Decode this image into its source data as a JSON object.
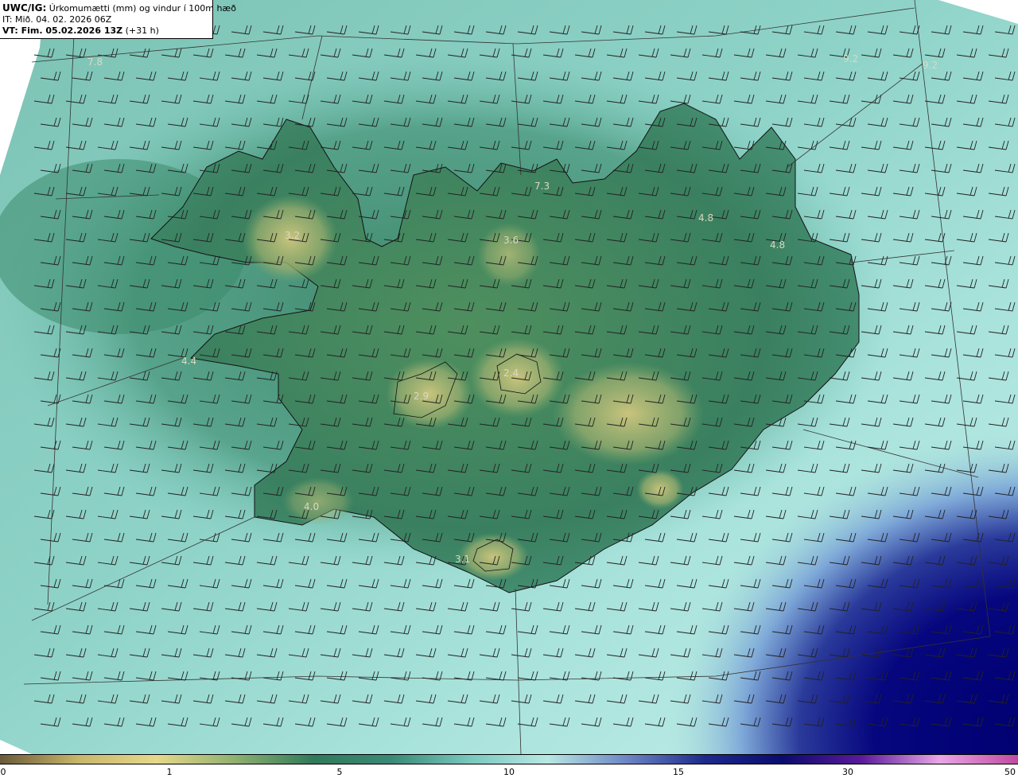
{
  "header": {
    "line1_bold": "UWC/IG:",
    "line1_rest": " Úrkomumætti (mm) og vindur í 100m hæð",
    "line2": "IT: Mið. 04. 02. 2026 06Z",
    "line3_bold": "VT: Fim. 05.02.2026 13Z",
    "line3_rest": " (+31 h)"
  },
  "map_labels": [
    {
      "text": "3.2"
    },
    {
      "text": "3.6"
    },
    {
      "text": "7.3"
    },
    {
      "text": "4.8"
    },
    {
      "text": "4.8"
    },
    {
      "text": "4.4"
    },
    {
      "text": "2.9"
    },
    {
      "text": "2.4"
    },
    {
      "text": "4.0"
    },
    {
      "text": "3.1"
    },
    {
      "text": "9.2"
    },
    {
      "text": "9.2"
    },
    {
      "text": "7.8"
    }
  ],
  "colorbar": {
    "ticks": [
      "0",
      "1",
      "5",
      "10",
      "15",
      "30",
      "50"
    ],
    "colors": [
      "#6b5a3a",
      "#c9b66a",
      "#e6d88a",
      "#8fb070",
      "#2f7a5a",
      "#3a8a76",
      "#79c8bf",
      "#b8e8e3",
      "#6e86c6",
      "#1d2a8c",
      "#0b0b6e",
      "#5a1a9a",
      "#e9a6e6",
      "#c04aa0"
    ]
  },
  "colors": {
    "sea_light": "#9fd9d2",
    "sea_mid": "#6fc0b2",
    "land_green": "#2f7a5a",
    "land_yellow": "#c6c27a",
    "deep_blue": "#0b0b7a"
  }
}
